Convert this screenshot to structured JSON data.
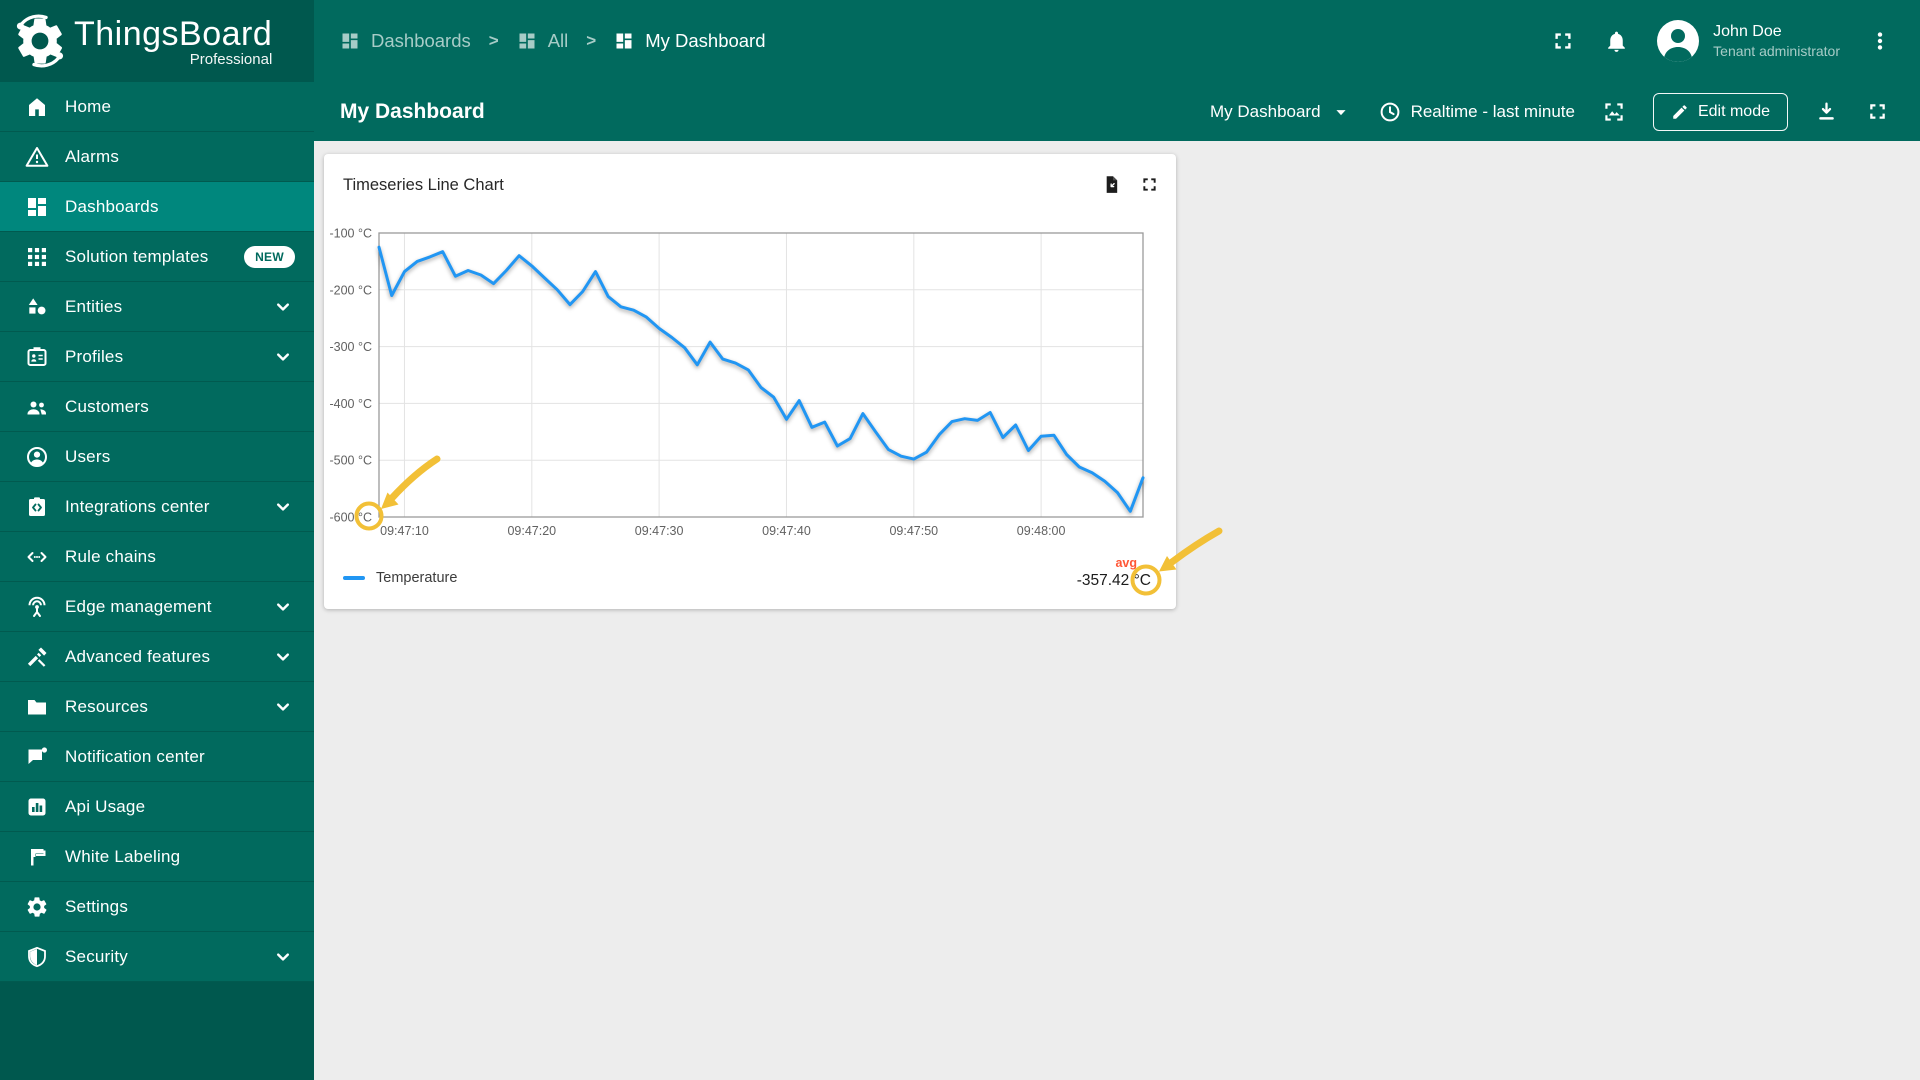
{
  "app": {
    "name": "ThingsBoard",
    "edition": "Professional"
  },
  "breadcrumb": {
    "items": [
      "Dashboards",
      "All",
      "My Dashboard"
    ],
    "separator": ">",
    "icon": "dashboards"
  },
  "header": {
    "icons": [
      "fullscreen-icon",
      "notifications-bell-icon",
      "avatar",
      "kebab-menu-icon"
    ]
  },
  "user": {
    "name": "John Doe",
    "role": "Tenant administrator"
  },
  "toolbar": {
    "title": "My Dashboard",
    "state_select": "My Dashboard",
    "timewindow": "Realtime - last minute",
    "edit_button": "Edit mode",
    "icons": [
      "clock-icon",
      "dashboard-image-icon",
      "pencil-icon",
      "download-icon",
      "fullscreen-icon"
    ]
  },
  "sidebar": {
    "items": [
      {
        "label": "Home",
        "icon": "home"
      },
      {
        "label": "Alarms",
        "icon": "alarms"
      },
      {
        "label": "Dashboards",
        "icon": "dashboards",
        "selected": true
      },
      {
        "label": "Solution templates",
        "icon": "solution-templates",
        "badge": "NEW"
      },
      {
        "label": "Entities",
        "icon": "entities",
        "expandable": true
      },
      {
        "label": "Profiles",
        "icon": "profiles",
        "expandable": true
      },
      {
        "label": "Customers",
        "icon": "customers"
      },
      {
        "label": "Users",
        "icon": "users"
      },
      {
        "label": "Integrations center",
        "icon": "integrations",
        "expandable": true
      },
      {
        "label": "Rule chains",
        "icon": "rule-chains"
      },
      {
        "label": "Edge management",
        "icon": "edge",
        "expandable": true
      },
      {
        "label": "Advanced features",
        "icon": "advanced",
        "expandable": true
      },
      {
        "label": "Resources",
        "icon": "resources",
        "expandable": true
      },
      {
        "label": "Notification center",
        "icon": "notifications"
      },
      {
        "label": "Api Usage",
        "icon": "api-usage"
      },
      {
        "label": "White Labeling",
        "icon": "white-labeling"
      },
      {
        "label": "Settings",
        "icon": "settings"
      },
      {
        "label": "Security",
        "icon": "security",
        "expandable": true
      }
    ]
  },
  "widget": {
    "title": "Timeseries Line Chart",
    "actions": [
      "export-data-icon",
      "expand-widget-icon"
    ],
    "legend": {
      "series": "Temperature",
      "agg_label": "avg",
      "agg_value": "-357.42 °C"
    }
  },
  "chart_data": {
    "type": "line",
    "title": "Timeseries Line Chart",
    "x_start": "09:47:08",
    "interval_s": 1,
    "x_ticks": [
      "09:47:10",
      "09:47:20",
      "09:47:30",
      "09:47:40",
      "09:47:50",
      "09:48:00"
    ],
    "y_ticks": [
      "-100 °C",
      "-200 °C",
      "-300 °C",
      "-400 °C",
      "-500 °C",
      "-600 °C"
    ],
    "ylim": [
      -600,
      -100
    ],
    "unit": "°C",
    "grid": true,
    "legend_position": "bottom",
    "avg": -357.42,
    "series": [
      {
        "name": "Temperature",
        "color": "#2196F3",
        "values": [
          -125,
          -210,
          -168,
          -150,
          -142,
          -133,
          -176,
          -166,
          -174,
          -189,
          -166,
          -140,
          -158,
          -179,
          -200,
          -226,
          -203,
          -168,
          -212,
          -230,
          -236,
          -248,
          -268,
          -284,
          -302,
          -332,
          -292,
          -322,
          -329,
          -341,
          -372,
          -389,
          -428,
          -395,
          -442,
          -433,
          -475,
          -462,
          -418,
          -450,
          -481,
          -493,
          -498,
          -486,
          -455,
          -432,
          -427,
          -430,
          -416,
          -460,
          -438,
          -483,
          -458,
          -456,
          -490,
          -512,
          -522,
          -537,
          -557,
          -590,
          -531
        ]
      }
    ]
  },
  "colors": {
    "teal_header": "#016A5E",
    "teal_dark": "#00584E",
    "teal_selected": "#00877D",
    "divider": "#015A4F",
    "muted": "#A7CCC7",
    "content_bg": "#EDEDED",
    "line": "#2196F3",
    "avg": "#FF5635",
    "annotation": "#F2C037",
    "grid": "#E3E3E3",
    "frame": "#9A9A9A",
    "tick": "#616161"
  }
}
